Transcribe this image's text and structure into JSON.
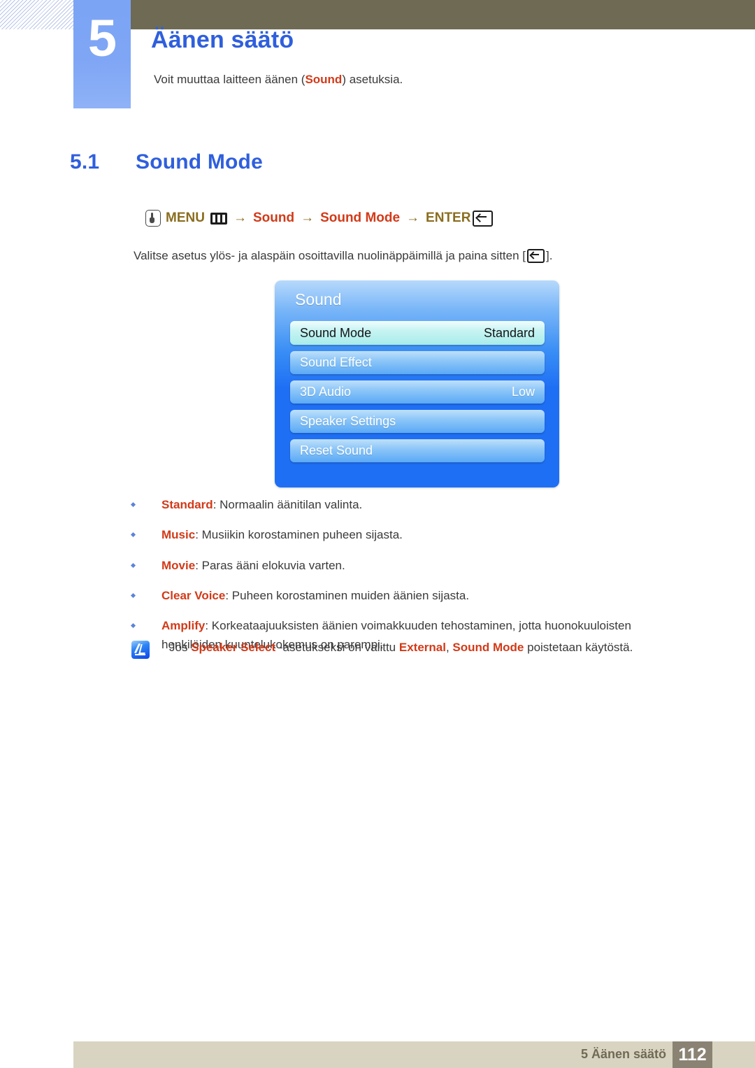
{
  "chapter": {
    "number": "5",
    "title": "Äänen säätö",
    "intro_before": "Voit muuttaa laitteen äänen (",
    "intro_keyword": "Sound",
    "intro_after": ") asetuksia."
  },
  "section": {
    "number": "5.1",
    "title": "Sound Mode"
  },
  "menu_path": {
    "button_icon": "press-button-icon",
    "menu_label": "MENU",
    "menu_icon": "menu-bars-icon",
    "arrow": "→",
    "step_sound": "Sound",
    "step_sound_mode": "Sound Mode",
    "enter_label": "ENTER",
    "enter_icon": "enter-key-icon"
  },
  "instruction": {
    "before": "Valitse asetus ylös- ja alaspäin osoittavilla nuolinäppäimillä ja paina sitten [",
    "after": "]."
  },
  "osd": {
    "title": "Sound",
    "rows": [
      {
        "label": "Sound Mode",
        "value": "Standard",
        "selected": true
      },
      {
        "label": "Sound Effect",
        "value": "",
        "selected": false
      },
      {
        "label": "3D Audio",
        "value": "Low",
        "selected": false
      },
      {
        "label": "Speaker Settings",
        "value": "",
        "selected": false
      },
      {
        "label": "Reset Sound",
        "value": "",
        "selected": false
      }
    ]
  },
  "bullets": [
    {
      "keyword": "Standard",
      "text": ": Normaalin äänitilan valinta."
    },
    {
      "keyword": "Music",
      "text": ": Musiikin korostaminen puheen sijasta."
    },
    {
      "keyword": "Movie",
      "text": ": Paras ääni elokuvia varten."
    },
    {
      "keyword": "Clear Voice",
      "text": ": Puheen korostaminen muiden äänien sijasta."
    },
    {
      "keyword": "Amplify",
      "text": ": Korkeataajuuksisten äänien voimakkuuden tehostaminen, jotta huonokuuloisten henkilöiden kuuntelukokemus on parempi."
    }
  ],
  "note": {
    "icon": "note-pen-icon",
    "part1": "Jos ",
    "kw1": "Speaker Select",
    "part2": " -asetukseksi on valittu ",
    "kw2": "External",
    "part3": ", ",
    "kw3": "Sound Mode",
    "part4": " poistetaan käytöstä."
  },
  "footer": {
    "label": "5 Äänen säätö",
    "page": "112"
  },
  "colors": {
    "accent_blue": "#2f5fdd",
    "keyword_red": "#d23a18",
    "menu_olive": "#8a6d1f",
    "header_olive": "#6e6a54",
    "footer_bar": "#d8d4c1",
    "footer_page_box": "#8a8273",
    "badge_blue": "#7ba4f5"
  }
}
